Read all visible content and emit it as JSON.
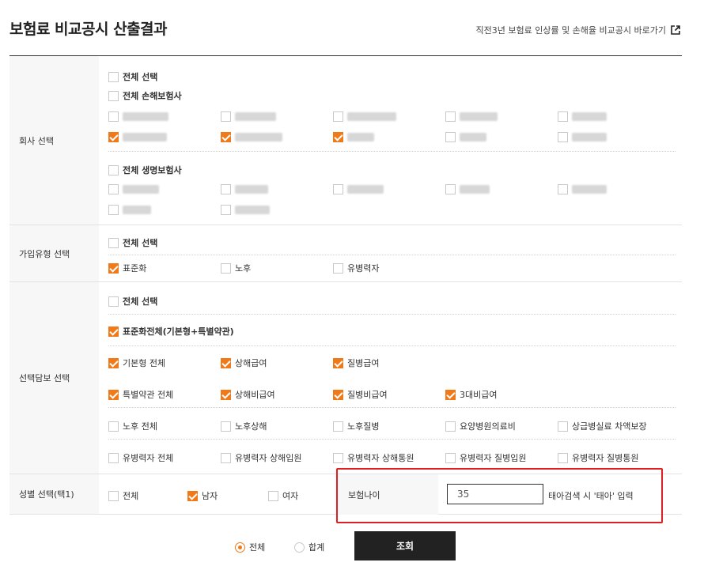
{
  "page_title": "보험료 비교공시 산출결과",
  "top_link": "직전3년 보험료 인상률 및 손해율 비교공시 바로가기",
  "company": {
    "label": "회사 선택",
    "select_all": "전체 선택",
    "nonlife_all": "전체 손해보험사",
    "life_all": "전체 생명보험사"
  },
  "join_type": {
    "label": "가입유형 선택",
    "select_all": "전체 선택",
    "options": [
      "표준화",
      "노후",
      "유병력자"
    ]
  },
  "coverage": {
    "label": "선택담보 선택",
    "select_all": "전체 선택",
    "standard_all": "표준화전체(기본형+특별약관)",
    "items": [
      "기본형 전체",
      "상해급여",
      "질병급여",
      "특별약관 전체",
      "상해비급여",
      "질병비급여",
      "3대비급여",
      "노후 전체",
      "노후상해",
      "노후질병",
      "요양병원의료비",
      "상급병실료 차액보장",
      "유병력자 전체",
      "유병력자 상해입원",
      "유병력자 상해통원",
      "유병력자 질병입원",
      "유병력자 질병통원"
    ]
  },
  "gender": {
    "label": "성별 선택(택1)",
    "options": [
      "전체",
      "남자",
      "여자"
    ]
  },
  "age": {
    "label": "보험나이",
    "value": "35",
    "hint": "태아검색 시 '태아' 입력"
  },
  "summary": {
    "options": [
      "전체",
      "합계"
    ]
  },
  "search_button": "조회",
  "colors": {
    "accent": "#f07a1a",
    "highlight": "#e02020"
  }
}
